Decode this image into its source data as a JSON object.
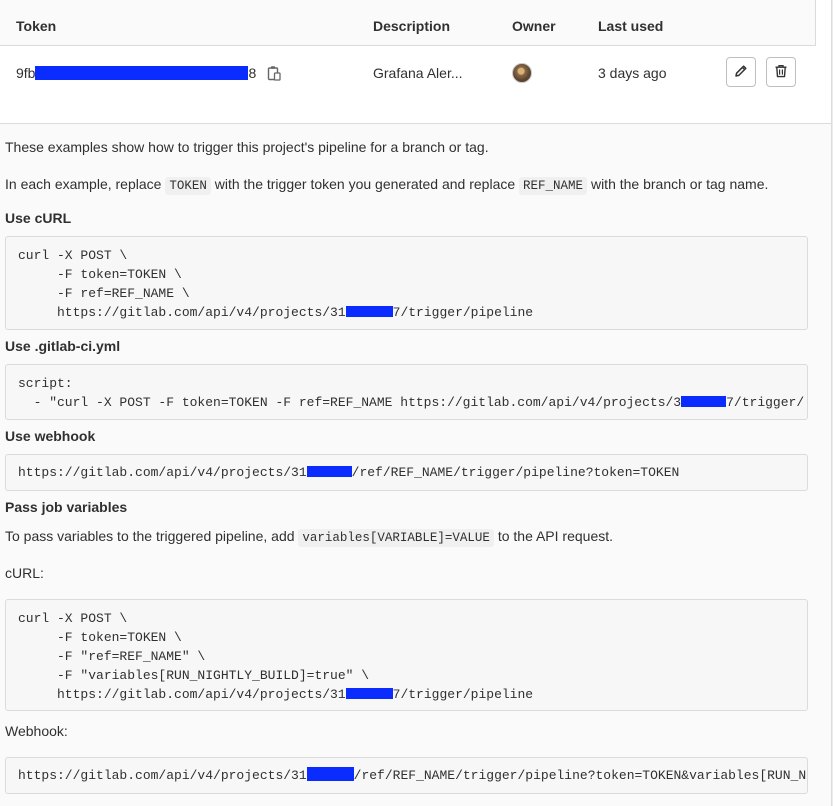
{
  "table": {
    "headers": {
      "token": "Token",
      "description": "Description",
      "owner": "Owner",
      "last_used": "Last used"
    },
    "row": {
      "token_prefix": "9fb",
      "token_suffix": "8",
      "description": "Grafana Aler...",
      "last_used": "3 days ago"
    }
  },
  "intro": {
    "line1": "These examples show how to trigger this project's pipeline for a branch or tag.",
    "line2_a": "In each example, replace ",
    "line2_code1": "TOKEN",
    "line2_b": " with the trigger token you generated and replace ",
    "line2_code2": "REF_NAME",
    "line2_c": " with the branch or tag name."
  },
  "sections": {
    "curl_heading": "Use cURL",
    "curl_lines": [
      "curl -X POST \\",
      "     -F token=TOKEN \\",
      "     -F ref=REF_NAME \\"
    ],
    "curl_url_a": "     https://gitlab.com/api/v4/projects/31",
    "curl_url_b": "7/trigger/pipeline",
    "ci_heading": "Use .gitlab-ci.yml",
    "ci_line1": "script:",
    "ci_line2_a": "  - \"curl -X POST -F token=TOKEN -F ref=REF_NAME https://gitlab.com/api/v4/projects/3",
    "ci_line2_b": "7/trigger/",
    "webhook_heading": "Use webhook",
    "webhook_a": "https://gitlab.com/api/v4/projects/31",
    "webhook_b": "/ref/REF_NAME/trigger/pipeline?token=TOKEN",
    "vars_heading": "Pass job variables",
    "vars_text_a": "To pass variables to the triggered pipeline, add ",
    "vars_code": "variables[VARIABLE]=VALUE",
    "vars_text_b": " to the API request.",
    "curl2_label": "cURL:",
    "curl2_lines": [
      "curl -X POST \\",
      "     -F token=TOKEN \\",
      "     -F \"ref=REF_NAME\" \\",
      "     -F \"variables[RUN_NIGHTLY_BUILD]=true\" \\"
    ],
    "curl2_url_a": "     https://gitlab.com/api/v4/projects/31",
    "curl2_url_b": "7/trigger/pipeline",
    "webhook2_label": "Webhook:",
    "webhook2_a": "https://gitlab.com/api/v4/projects/31",
    "webhook2_b": "/ref/REF_NAME/trigger/pipeline?token=TOKEN&variables[RUN_N"
  },
  "icons": {
    "copy": "copy-icon",
    "edit": "pencil-icon",
    "delete": "trash-icon"
  },
  "colors": {
    "redaction": "#0a2cff"
  }
}
